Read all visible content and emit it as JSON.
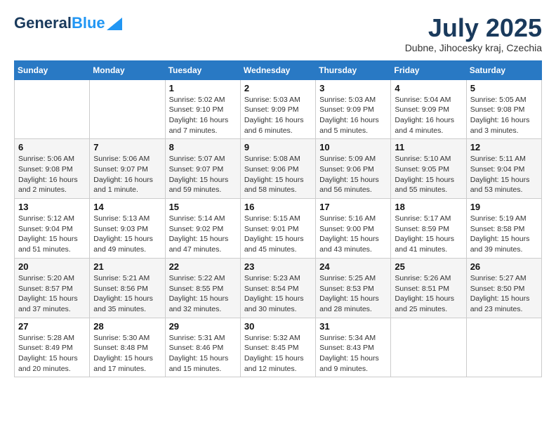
{
  "header": {
    "logo_general": "General",
    "logo_blue": "Blue",
    "month_title": "July 2025",
    "location": "Dubne, Jihocesky kraj, Czechia"
  },
  "weekdays": [
    "Sunday",
    "Monday",
    "Tuesday",
    "Wednesday",
    "Thursday",
    "Friday",
    "Saturday"
  ],
  "weeks": [
    [
      {
        "day": "",
        "info": ""
      },
      {
        "day": "",
        "info": ""
      },
      {
        "day": "1",
        "info": "Sunrise: 5:02 AM\nSunset: 9:10 PM\nDaylight: 16 hours and 7 minutes."
      },
      {
        "day": "2",
        "info": "Sunrise: 5:03 AM\nSunset: 9:09 PM\nDaylight: 16 hours and 6 minutes."
      },
      {
        "day": "3",
        "info": "Sunrise: 5:03 AM\nSunset: 9:09 PM\nDaylight: 16 hours and 5 minutes."
      },
      {
        "day": "4",
        "info": "Sunrise: 5:04 AM\nSunset: 9:09 PM\nDaylight: 16 hours and 4 minutes."
      },
      {
        "day": "5",
        "info": "Sunrise: 5:05 AM\nSunset: 9:08 PM\nDaylight: 16 hours and 3 minutes."
      }
    ],
    [
      {
        "day": "6",
        "info": "Sunrise: 5:06 AM\nSunset: 9:08 PM\nDaylight: 16 hours and 2 minutes."
      },
      {
        "day": "7",
        "info": "Sunrise: 5:06 AM\nSunset: 9:07 PM\nDaylight: 16 hours and 1 minute."
      },
      {
        "day": "8",
        "info": "Sunrise: 5:07 AM\nSunset: 9:07 PM\nDaylight: 15 hours and 59 minutes."
      },
      {
        "day": "9",
        "info": "Sunrise: 5:08 AM\nSunset: 9:06 PM\nDaylight: 15 hours and 58 minutes."
      },
      {
        "day": "10",
        "info": "Sunrise: 5:09 AM\nSunset: 9:06 PM\nDaylight: 15 hours and 56 minutes."
      },
      {
        "day": "11",
        "info": "Sunrise: 5:10 AM\nSunset: 9:05 PM\nDaylight: 15 hours and 55 minutes."
      },
      {
        "day": "12",
        "info": "Sunrise: 5:11 AM\nSunset: 9:04 PM\nDaylight: 15 hours and 53 minutes."
      }
    ],
    [
      {
        "day": "13",
        "info": "Sunrise: 5:12 AM\nSunset: 9:04 PM\nDaylight: 15 hours and 51 minutes."
      },
      {
        "day": "14",
        "info": "Sunrise: 5:13 AM\nSunset: 9:03 PM\nDaylight: 15 hours and 49 minutes."
      },
      {
        "day": "15",
        "info": "Sunrise: 5:14 AM\nSunset: 9:02 PM\nDaylight: 15 hours and 47 minutes."
      },
      {
        "day": "16",
        "info": "Sunrise: 5:15 AM\nSunset: 9:01 PM\nDaylight: 15 hours and 45 minutes."
      },
      {
        "day": "17",
        "info": "Sunrise: 5:16 AM\nSunset: 9:00 PM\nDaylight: 15 hours and 43 minutes."
      },
      {
        "day": "18",
        "info": "Sunrise: 5:17 AM\nSunset: 8:59 PM\nDaylight: 15 hours and 41 minutes."
      },
      {
        "day": "19",
        "info": "Sunrise: 5:19 AM\nSunset: 8:58 PM\nDaylight: 15 hours and 39 minutes."
      }
    ],
    [
      {
        "day": "20",
        "info": "Sunrise: 5:20 AM\nSunset: 8:57 PM\nDaylight: 15 hours and 37 minutes."
      },
      {
        "day": "21",
        "info": "Sunrise: 5:21 AM\nSunset: 8:56 PM\nDaylight: 15 hours and 35 minutes."
      },
      {
        "day": "22",
        "info": "Sunrise: 5:22 AM\nSunset: 8:55 PM\nDaylight: 15 hours and 32 minutes."
      },
      {
        "day": "23",
        "info": "Sunrise: 5:23 AM\nSunset: 8:54 PM\nDaylight: 15 hours and 30 minutes."
      },
      {
        "day": "24",
        "info": "Sunrise: 5:25 AM\nSunset: 8:53 PM\nDaylight: 15 hours and 28 minutes."
      },
      {
        "day": "25",
        "info": "Sunrise: 5:26 AM\nSunset: 8:51 PM\nDaylight: 15 hours and 25 minutes."
      },
      {
        "day": "26",
        "info": "Sunrise: 5:27 AM\nSunset: 8:50 PM\nDaylight: 15 hours and 23 minutes."
      }
    ],
    [
      {
        "day": "27",
        "info": "Sunrise: 5:28 AM\nSunset: 8:49 PM\nDaylight: 15 hours and 20 minutes."
      },
      {
        "day": "28",
        "info": "Sunrise: 5:30 AM\nSunset: 8:48 PM\nDaylight: 15 hours and 17 minutes."
      },
      {
        "day": "29",
        "info": "Sunrise: 5:31 AM\nSunset: 8:46 PM\nDaylight: 15 hours and 15 minutes."
      },
      {
        "day": "30",
        "info": "Sunrise: 5:32 AM\nSunset: 8:45 PM\nDaylight: 15 hours and 12 minutes."
      },
      {
        "day": "31",
        "info": "Sunrise: 5:34 AM\nSunset: 8:43 PM\nDaylight: 15 hours and 9 minutes."
      },
      {
        "day": "",
        "info": ""
      },
      {
        "day": "",
        "info": ""
      }
    ]
  ]
}
